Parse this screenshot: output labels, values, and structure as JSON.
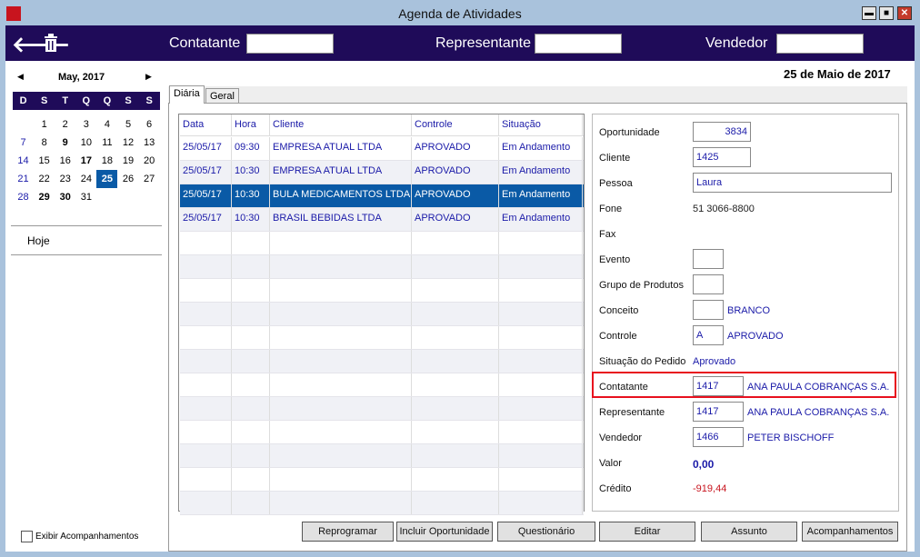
{
  "window": {
    "title": "Agenda de Atividades",
    "min": "▬",
    "max": "■",
    "close": "✕"
  },
  "header": {
    "back_icon": "arrow-left",
    "trash_icon": "trash",
    "contatante_label": "Contatante",
    "contatante_value": "",
    "representante_label": "Representante",
    "representante_value": "",
    "vendedor_label": "Vendedor",
    "vendedor_value": ""
  },
  "date_title": "25 de Maio de 2017",
  "calendar": {
    "month": "May, 2017",
    "prev": "◀",
    "next": "▶",
    "weekdays": [
      "D",
      "S",
      "T",
      "Q",
      "Q",
      "S",
      "S"
    ],
    "weeks": [
      [
        "",
        "1",
        "2",
        "3",
        "4",
        "5",
        "6"
      ],
      [
        "7",
        "8",
        "9",
        "10",
        "11",
        "12",
        "13"
      ],
      [
        "14",
        "15",
        "16",
        "17",
        "18",
        "19",
        "20"
      ],
      [
        "21",
        "22",
        "23",
        "24",
        "25",
        "26",
        "27"
      ],
      [
        "28",
        "29",
        "30",
        "31",
        "",
        "",
        ""
      ]
    ],
    "bold": [
      "9",
      "17",
      "29",
      "30"
    ],
    "selected": "25",
    "today_label": "Hoje"
  },
  "show_followups": {
    "label": "Exibir Acompanhamentos",
    "checked": false
  },
  "tabs": [
    {
      "label": "Diária",
      "active": true
    },
    {
      "label": "Geral",
      "active": false
    }
  ],
  "grid": {
    "columns": [
      "Data",
      "Hora",
      "Cliente",
      "Controle",
      "Situação"
    ],
    "rows": [
      [
        "25/05/17",
        "09:30",
        "EMPRESA ATUAL LTDA",
        "APROVADO",
        "Em Andamento"
      ],
      [
        "25/05/17",
        "10:30",
        "EMPRESA ATUAL LTDA",
        "APROVADO",
        "Em Andamento"
      ],
      [
        "25/05/17",
        "10:30",
        "BULA MEDICAMENTOS LTDA",
        "APROVADO",
        "Em Andamento"
      ],
      [
        "25/05/17",
        "10:30",
        "BRASIL BEBIDAS LTDA",
        "APROVADO",
        "Em Andamento"
      ]
    ],
    "selected_row": 2,
    "empty_rows": 12
  },
  "details": [
    {
      "label": "Oportunidade",
      "input": "3834",
      "align": "right",
      "w": 64
    },
    {
      "label": "Cliente",
      "input": "1425",
      "w": 64
    },
    {
      "label": "Pessoa",
      "input": "Laura",
      "w": 219
    },
    {
      "label": "Fone",
      "text": "51 3066-8800",
      "dark": true
    },
    {
      "label": "Fax"
    },
    {
      "label": "Evento",
      "input": "",
      "w": 34
    },
    {
      "label": "Grupo de Produtos",
      "input": "",
      "w": 34
    },
    {
      "label": "Conceito",
      "input": "",
      "w": 34,
      "extra": "BRANCO"
    },
    {
      "label": "Controle",
      "input": "A",
      "w": 34,
      "extra": "APROVADO"
    },
    {
      "label": "Situação do Pedido",
      "text": "Aprovado"
    },
    {
      "label": "Contatante",
      "input": "1417",
      "w": 56,
      "extra": "ANA PAULA COBRANÇAS S.A.",
      "highlight": true
    },
    {
      "label": "Representante",
      "input": "1417",
      "w": 56,
      "extra": "ANA PAULA COBRANÇAS S.A."
    },
    {
      "label": "Vendedor",
      "input": "1466",
      "w": 56,
      "extra": "PETER BISCHOFF"
    },
    {
      "label": "Valor",
      "text": "0,00",
      "bold": true
    },
    {
      "label": "Crédito",
      "text": "-919,44",
      "red": true
    }
  ],
  "buttons": [
    "Reprogramar",
    "Incluir Oportunidade",
    "Questionário",
    "Editar",
    "Assunto",
    "Acompanhamentos"
  ],
  "colors": {
    "header": "#1f0b59",
    "selection": "#0a5aa6",
    "highlight": "#e8101e",
    "link": "#1a1aa8"
  }
}
